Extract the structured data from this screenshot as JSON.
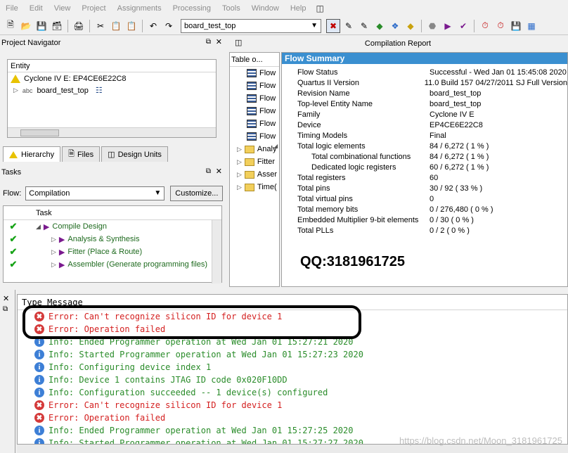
{
  "menu": [
    "File",
    "Edit",
    "View",
    "Project",
    "Assignments",
    "Processing",
    "Tools",
    "Window",
    "Help"
  ],
  "toolbar": {
    "entity": "board_test_top"
  },
  "project_navigator": {
    "title": "Project Navigator",
    "header": "Entity",
    "device": "Cyclone IV E: EP4CE6E22C8",
    "top": "board_test_top",
    "tabs": [
      "Hierarchy",
      "Files",
      "Design Units"
    ]
  },
  "tasks": {
    "title": "Tasks",
    "flow_label": "Flow:",
    "flow_value": "Compilation",
    "customize": "Customize...",
    "col": "Task",
    "rows": [
      "Compile Design",
      "Analysis & Synthesis",
      "Fitter (Place & Route)",
      "Assembler (Generate programming files)"
    ]
  },
  "report": {
    "title": "Compilation Report",
    "toc_title": "Table o...",
    "toc_items": [
      "Flow",
      "Flow",
      "Flow",
      "Flow",
      "Flow",
      "Flow"
    ],
    "toc_folders": [
      "Analy",
      "Fitter",
      "Asser",
      "Time("
    ],
    "summary_title": "Flow Summary",
    "rows": [
      {
        "k": "Flow Status",
        "v": "Successful - Wed Jan 01 15:45:08 2020",
        "sub": false
      },
      {
        "k": "Quartus II Version",
        "v": "11.0 Build 157 04/27/2011 SJ Full Version",
        "sub": false
      },
      {
        "k": "Revision Name",
        "v": "board_test_top",
        "sub": false
      },
      {
        "k": "Top-level Entity Name",
        "v": "board_test_top",
        "sub": false
      },
      {
        "k": "Family",
        "v": "Cyclone IV E",
        "sub": false
      },
      {
        "k": "Device",
        "v": "EP4CE6E22C8",
        "sub": false
      },
      {
        "k": "Timing Models",
        "v": "Final",
        "sub": false
      },
      {
        "k": "Total logic elements",
        "v": "84 / 6,272 ( 1 % )",
        "sub": false
      },
      {
        "k": "Total combinational functions",
        "v": "84 / 6,272 ( 1 % )",
        "sub": true
      },
      {
        "k": "Dedicated logic registers",
        "v": "60 / 6,272 ( 1 % )",
        "sub": true
      },
      {
        "k": "Total registers",
        "v": "60",
        "sub": false
      },
      {
        "k": "Total pins",
        "v": "30 / 92 ( 33 % )",
        "sub": false
      },
      {
        "k": "Total virtual pins",
        "v": "0",
        "sub": false
      },
      {
        "k": "Total memory bits",
        "v": "0 / 276,480 ( 0 % )",
        "sub": false
      },
      {
        "k": "Embedded Multiplier 9-bit elements",
        "v": "0 / 30 ( 0 % )",
        "sub": false
      },
      {
        "k": "Total PLLs",
        "v": "0 / 2 ( 0 % )",
        "sub": false
      }
    ],
    "qq": "QQ:3181961725"
  },
  "messages": {
    "header": "Type Message",
    "rows": [
      {
        "type": "error",
        "text": "Error: Can't recognize silicon ID for device 1"
      },
      {
        "type": "error",
        "text": "Error: Operation failed"
      },
      {
        "type": "info",
        "text": "Info: Ended Programmer operation at Wed Jan 01 15:27:21 2020"
      },
      {
        "type": "info",
        "text": "Info: Started Programmer operation at Wed Jan 01 15:27:23 2020"
      },
      {
        "type": "info",
        "text": "Info: Configuring device index 1"
      },
      {
        "type": "info",
        "text": "Info: Device 1 contains JTAG ID code 0x020F10DD"
      },
      {
        "type": "info",
        "text": "Info: Configuration succeeded -- 1 device(s) configured"
      },
      {
        "type": "error",
        "text": "Error: Can't recognize silicon ID for device 1"
      },
      {
        "type": "error",
        "text": "Error: Operation failed"
      },
      {
        "type": "info",
        "text": "Info: Ended Programmer operation at Wed Jan 01 15:27:25 2020"
      },
      {
        "type": "info",
        "text": "Info: Started Programmer operation at Wed Jan 01 15:27:27 2020"
      }
    ],
    "watermark": "https://blog.csdn.net/Moon_3181961725"
  },
  "colors": {
    "error": "#d42020",
    "info": "#2a8c2a",
    "summary_header": "#3a8fd0"
  }
}
